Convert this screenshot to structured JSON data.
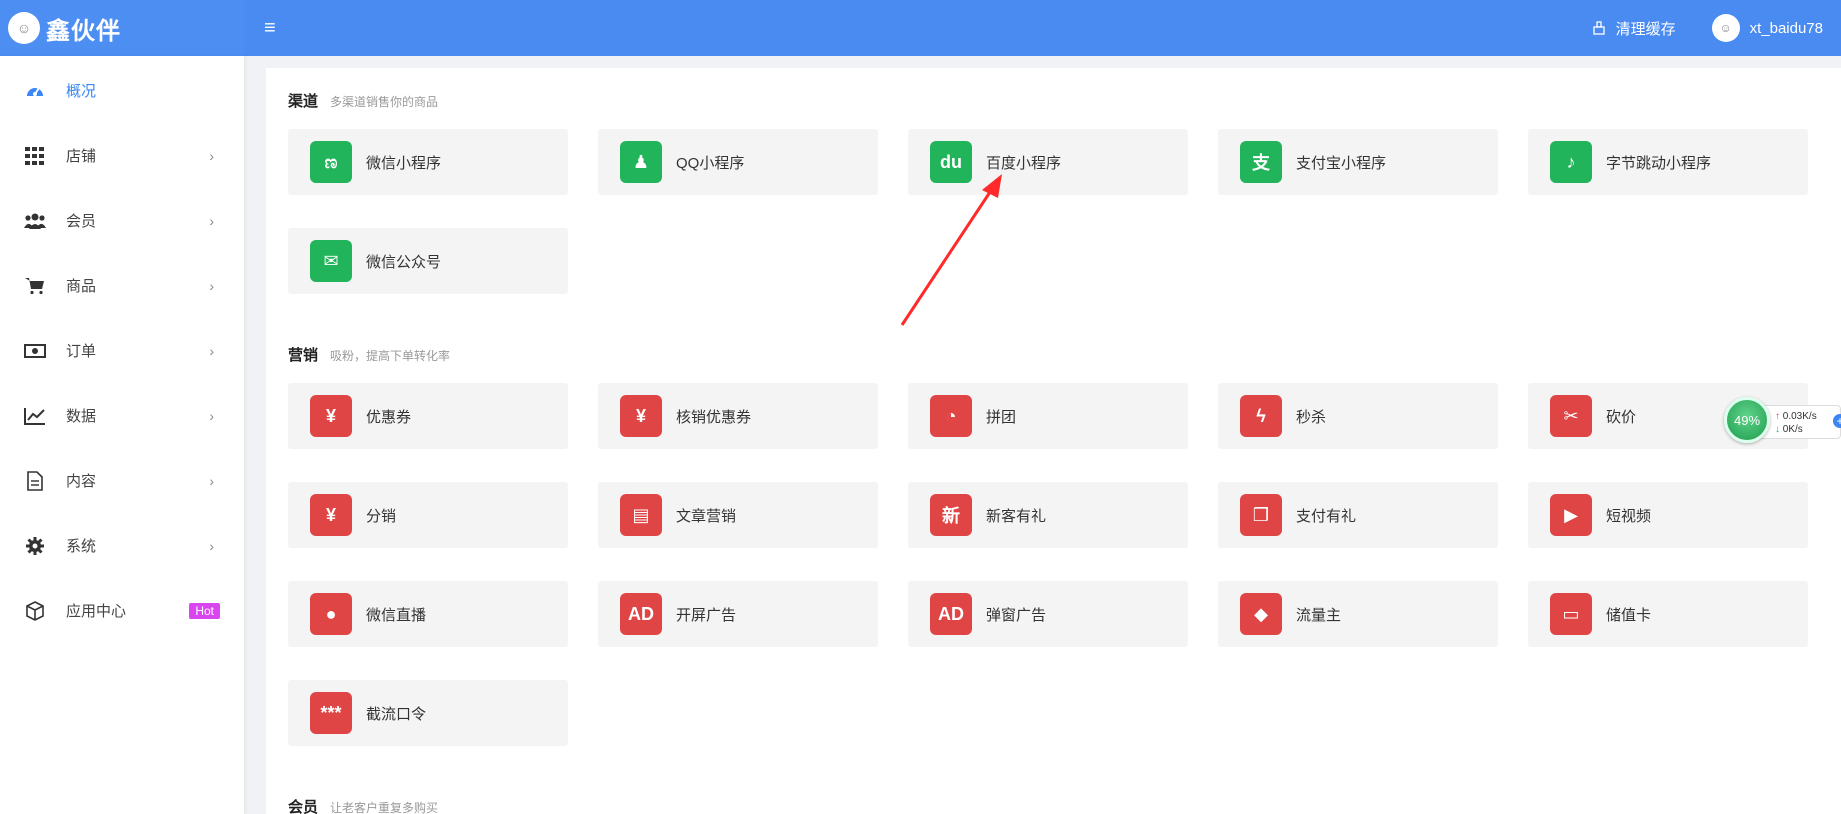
{
  "header": {
    "logo_text": "鑫伙伴",
    "menu_icon": "hamburger-icon",
    "clear_cache": "清理缓存",
    "username": "xt_baidu78"
  },
  "sidebar": {
    "items": [
      {
        "label": "概况",
        "icon": "dashboard-icon"
      },
      {
        "label": "店铺",
        "icon": "grid-icon"
      },
      {
        "label": "会员",
        "icon": "users-icon"
      },
      {
        "label": "商品",
        "icon": "cart-icon"
      },
      {
        "label": "订单",
        "icon": "money-icon"
      },
      {
        "label": "数据",
        "icon": "chart-icon"
      },
      {
        "label": "内容",
        "icon": "document-icon"
      },
      {
        "label": "系统",
        "icon": "gear-icon"
      },
      {
        "label": "应用中心",
        "icon": "box-icon",
        "badge": "Hot"
      }
    ]
  },
  "sections": {
    "channel": {
      "title": "渠道",
      "subtitle": "多渠道销售你的商品",
      "cards": [
        {
          "label": "微信小程序",
          "icon": "wechat-miniprogram-icon",
          "glyph": "ಣ"
        },
        {
          "label": "QQ小程序",
          "icon": "qq-icon",
          "glyph": "♟"
        },
        {
          "label": "百度小程序",
          "icon": "baidu-icon",
          "glyph": "du"
        },
        {
          "label": "支付宝小程序",
          "icon": "alipay-icon",
          "glyph": "支"
        },
        {
          "label": "字节跳动小程序",
          "icon": "tiktok-icon",
          "glyph": "♪"
        },
        {
          "label": "微信公众号",
          "icon": "wechat-icon",
          "glyph": "✉"
        }
      ]
    },
    "marketing": {
      "title": "营销",
      "subtitle": "吸粉，提高下单转化率",
      "cards": [
        {
          "label": "优惠券",
          "icon": "coupon-icon",
          "glyph": "¥"
        },
        {
          "label": "核销优惠券",
          "icon": "verify-coupon-icon",
          "glyph": "¥"
        },
        {
          "label": "拼团",
          "icon": "group-buy-icon",
          "glyph": "◔"
        },
        {
          "label": "秒杀",
          "icon": "flash-icon",
          "glyph": "ϟ"
        },
        {
          "label": "砍价",
          "icon": "bargain-icon",
          "glyph": "✂"
        },
        {
          "label": "分销",
          "icon": "money-bag-icon",
          "glyph": "¥"
        },
        {
          "label": "文章营销",
          "icon": "article-icon",
          "glyph": "▤"
        },
        {
          "label": "新客有礼",
          "icon": "new-customer-icon",
          "glyph": "新"
        },
        {
          "label": "支付有礼",
          "icon": "gift-icon",
          "glyph": "❒"
        },
        {
          "label": "短视频",
          "icon": "video-icon",
          "glyph": "▶"
        },
        {
          "label": "微信直播",
          "icon": "live-camera-icon",
          "glyph": "●"
        },
        {
          "label": "开屏广告",
          "icon": "splash-ad-icon",
          "glyph": "AD"
        },
        {
          "label": "弹窗广告",
          "icon": "popup-ad-icon",
          "glyph": "AD"
        },
        {
          "label": "流量主",
          "icon": "traffic-icon",
          "glyph": "◆"
        },
        {
          "label": "储值卡",
          "icon": "card-icon",
          "glyph": "▭"
        },
        {
          "label": "截流口令",
          "icon": "password-icon",
          "glyph": "***"
        }
      ]
    },
    "member": {
      "title": "会员",
      "subtitle": "让老客户重复多购买"
    }
  },
  "speed_widget": {
    "percent": "49%",
    "up": "0.03K/s",
    "down": "0K/s"
  },
  "colors": {
    "header": "#4a8bf2",
    "active": "#3b86f5",
    "channel_icon": "#21b45a",
    "marketing_icon": "#e04545",
    "hot_badge": "#d946ef",
    "annotation_arrow": "#ff2a2a"
  }
}
